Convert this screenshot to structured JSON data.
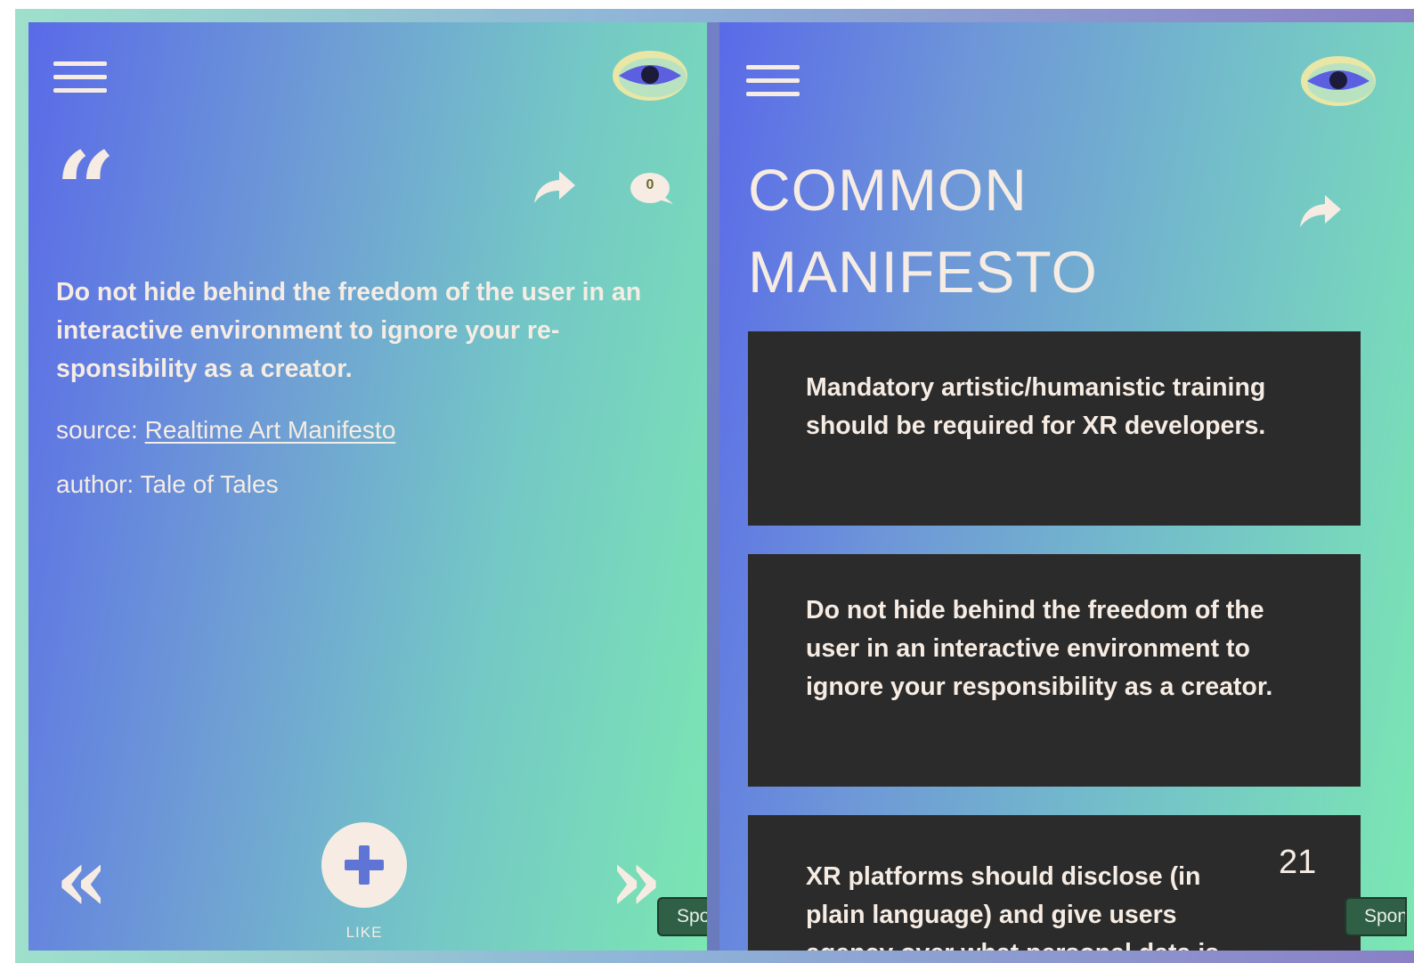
{
  "left_panel": {
    "quote_glyph": "“",
    "comment_count": "0",
    "quote_text": "Do not hide behind the freedom of the user in an interactive environment to ignore your re-sponsibility as a creator.",
    "source_label": "source: ",
    "source_link": "Realtime Art Manifesto",
    "author": "author: Tale of Tales",
    "prev_glyph": "«",
    "next_glyph": "»",
    "like_label": "LIKE",
    "sponsor_tab": "Sponsor"
  },
  "right_panel": {
    "title_line1": "COMMON",
    "title_line2": "MANIFESTO",
    "cards": [
      "Mandatory artistic/humanistic training should be required for XR developers.",
      "Do not hide behind the freedom of the user in an interactive environment to ignore your responsibility as a creator.",
      "XR platforms should disclose (in plain language) and give users agency over what personal data is"
    ],
    "page_number": "21",
    "sponsor_tab": "Sponsor"
  },
  "colors": {
    "text": "#f6ece3",
    "card_bg": "#2b2b2b",
    "gradient_start": "#5a6ae8",
    "gradient_end": "#7be6b2",
    "sponsor_bg": "#2f5f45"
  },
  "icons": [
    "hamburger-menu-icon",
    "eye-logo-icon",
    "share-arrow-icon",
    "comment-bubble-icon",
    "plus-icon"
  ]
}
